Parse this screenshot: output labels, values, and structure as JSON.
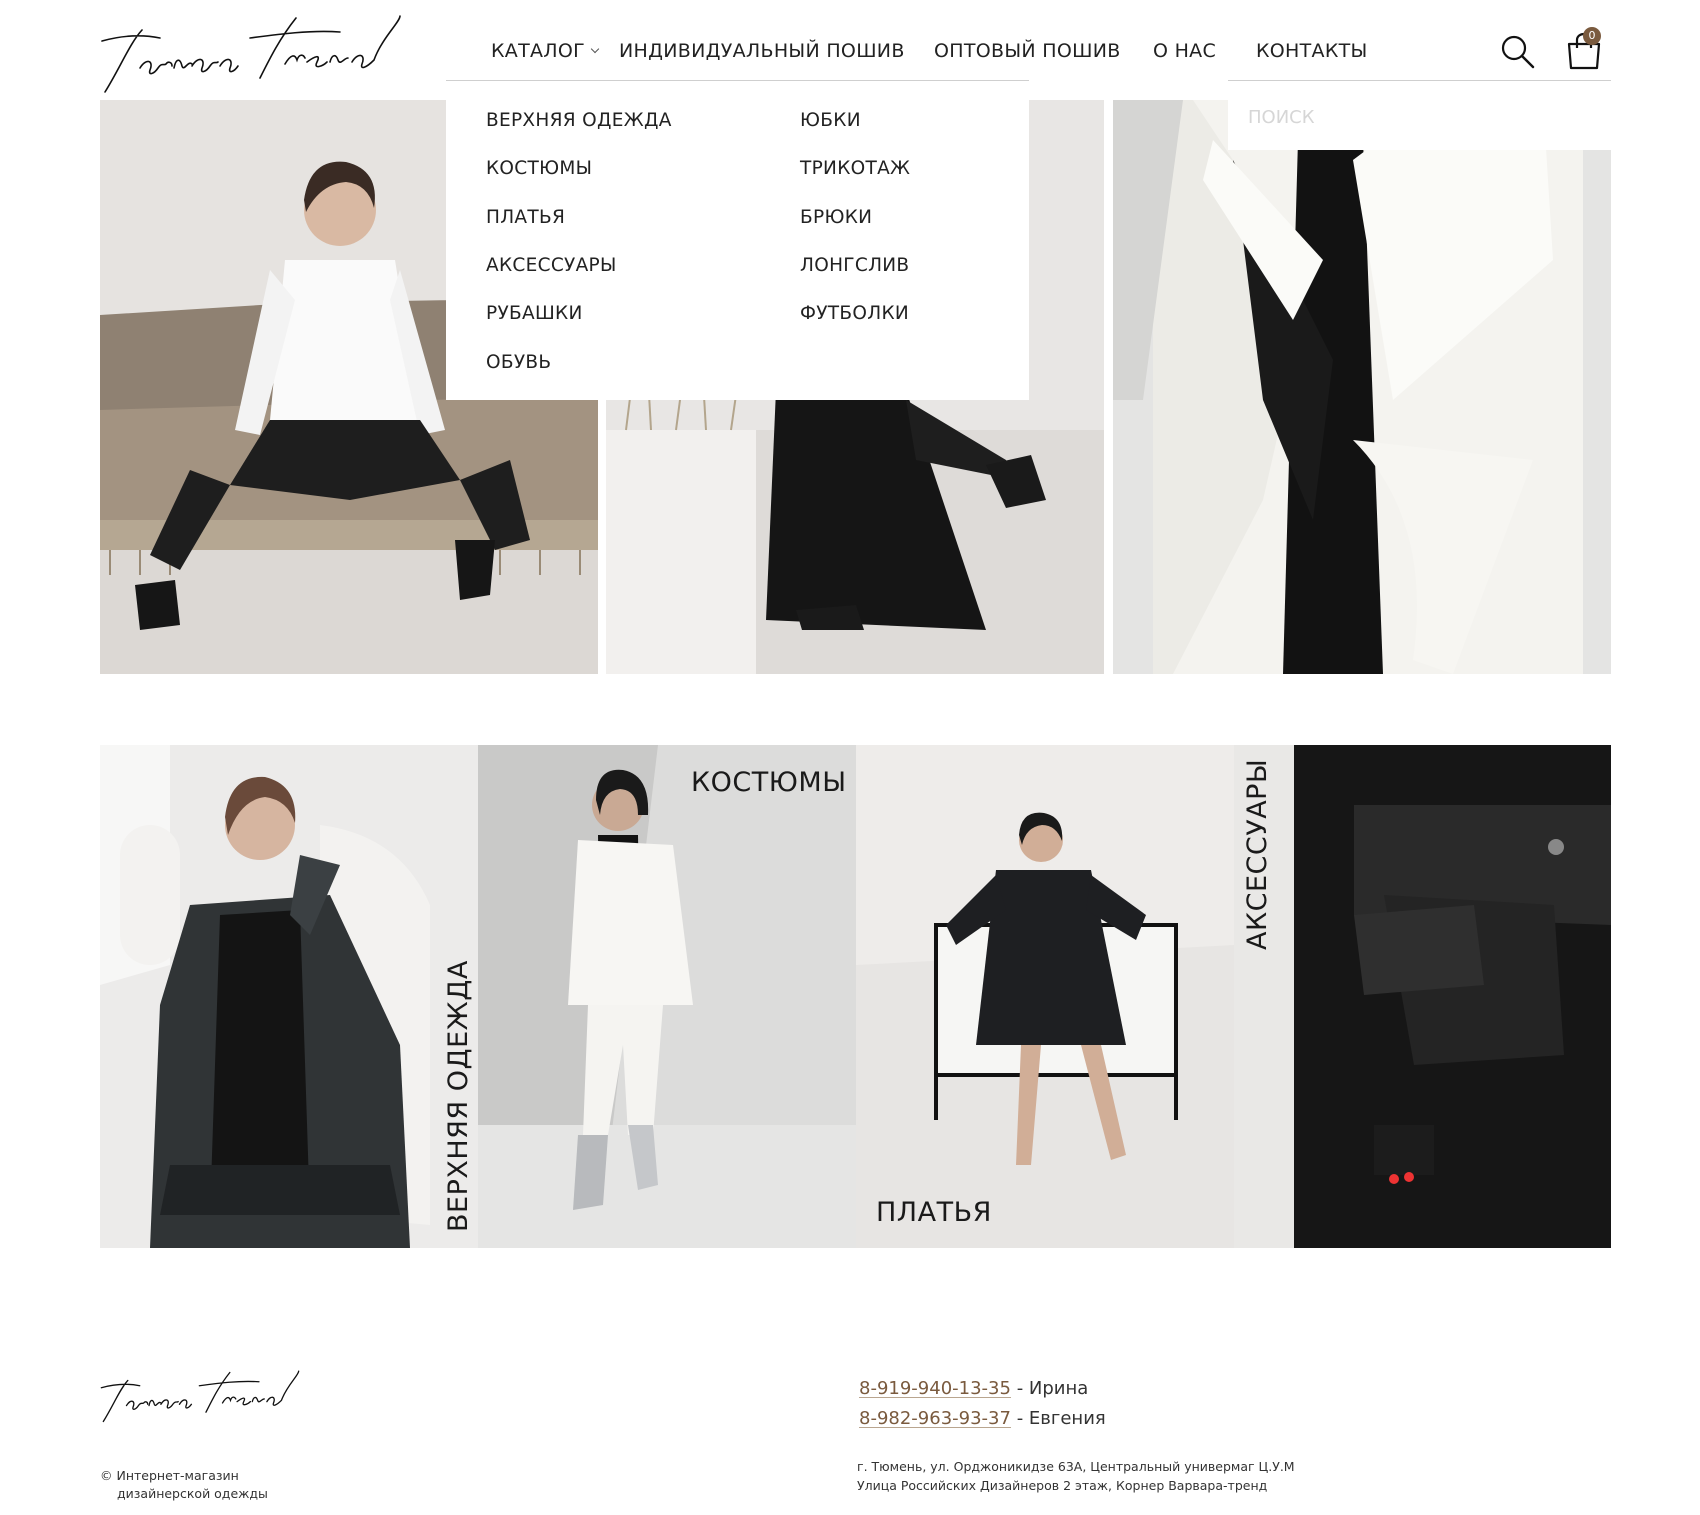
{
  "header": {
    "brand": "Varvara trend",
    "nav": [
      {
        "label": "КАТАЛОГ"
      },
      {
        "label": "ИНДИВИДУАЛЬНЫЙ ПОШИВ"
      },
      {
        "label": "ОПТОВЫЙ ПОШИВ"
      },
      {
        "label": "О НАС"
      },
      {
        "label": "КОНТАКТЫ"
      }
    ],
    "cart_count": "0",
    "icons": {
      "search": "search-icon",
      "cart": "shopping-bag-icon",
      "catalog": "chevron-down-icon"
    }
  },
  "catalog_menu": {
    "col1": [
      "ВЕРХНЯЯ ОДЕЖДА",
      "КОСТЮМЫ",
      "ПЛАТЬЯ",
      "АКСЕССУАРЫ",
      "РУБАШКИ",
      "ОБУВЬ"
    ],
    "col2": [
      "ЮБКИ",
      "ТРИКОТАЖ",
      "БРЮКИ",
      "ЛОНГСЛИВ",
      "ФУТБОЛКИ"
    ]
  },
  "search": {
    "placeholder": "ПОИСК"
  },
  "categories": [
    {
      "label": "ВЕРХНЯЯ ОДЕЖДА"
    },
    {
      "label": "КОСТЮМЫ"
    },
    {
      "label": "ПЛАТЬЯ"
    },
    {
      "label": "АКСЕССУАРЫ"
    }
  ],
  "footer": {
    "brand": "Varvara trend",
    "copyright_line1": "© Интернет-магазин",
    "copyright_line2": "дизайнерской одежды",
    "contacts": [
      {
        "phone": "8-919-940-13-35",
        "name": " - Ирина"
      },
      {
        "phone": "8-982-963-93-37",
        "name": " - Евгения"
      }
    ],
    "address_line1": "г. Тюмень, ул. Орджоникидзе 63А, Центральный универмаг Ц.У.М",
    "address_line2": "Улица Российских Дизайнеров 2 этаж, Корнер Варвара-тренд"
  },
  "colors": {
    "accent": "#7a5a3e",
    "text": "#1a1a1a",
    "placeholder": "#d6d6d6"
  }
}
